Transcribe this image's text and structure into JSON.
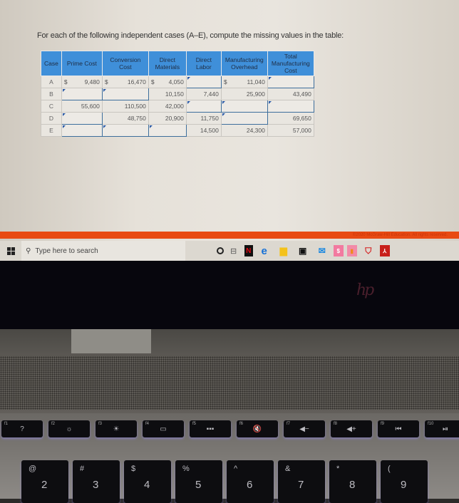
{
  "instructions": "For each of the following independent cases (A–E), compute the missing values in the table:",
  "table": {
    "headers": [
      "Case",
      "Prime Cost",
      "Conversion Cost",
      "Direct Materials",
      "Direct Labor",
      "Manufacturing Overhead",
      "Total Manufacturing Cost"
    ],
    "rows": [
      {
        "case": "A",
        "prime_cost": "9,480",
        "conversion_cost": "16,470",
        "direct_materials": "4,050",
        "direct_labor": "",
        "manufacturing_overhead": "11,040",
        "total_manufacturing_cost": ""
      },
      {
        "case": "B",
        "prime_cost": "",
        "conversion_cost": "",
        "direct_materials": "10,150",
        "direct_labor": "7,440",
        "manufacturing_overhead": "25,900",
        "total_manufacturing_cost": "43,490"
      },
      {
        "case": "C",
        "prime_cost": "55,600",
        "conversion_cost": "110,500",
        "direct_materials": "42,000",
        "direct_labor": "",
        "manufacturing_overhead": "",
        "total_manufacturing_cost": ""
      },
      {
        "case": "D",
        "prime_cost": "",
        "conversion_cost": "48,750",
        "direct_materials": "20,900",
        "direct_labor": "11,750",
        "manufacturing_overhead": "",
        "total_manufacturing_cost": "69,650"
      },
      {
        "case": "E",
        "prime_cost": "",
        "conversion_cost": "",
        "direct_materials": "",
        "direct_labor": "14,500",
        "manufacturing_overhead": "24,300",
        "total_manufacturing_cost": "57,000"
      }
    ],
    "currency_symbol": "$"
  },
  "copyright": "©2020 McGraw-Hill Education. All rights reserved.",
  "taskbar": {
    "search_placeholder": "Type here to search",
    "apps": [
      "netflix-icon",
      "edge-icon",
      "file-explorer-icon",
      "store-icon",
      "mail-icon",
      "app-pink-icon",
      "app-orange-icon",
      "mcafee-icon",
      "acrobat-icon"
    ]
  },
  "laptop_brand": "hp",
  "keyboard": {
    "function_keys": [
      {
        "fn": "f1",
        "symbol": "?"
      },
      {
        "fn": "f2",
        "symbol": "☼"
      },
      {
        "fn": "f3",
        "symbol": "☀"
      },
      {
        "fn": "f4",
        "symbol": "▭"
      },
      {
        "fn": "f5",
        "symbol": "▪▪▪"
      },
      {
        "fn": "f6",
        "symbol": "🔇"
      },
      {
        "fn": "f7",
        "symbol": "◀−"
      },
      {
        "fn": "f8",
        "symbol": "◀+"
      },
      {
        "fn": "f9",
        "symbol": "⏮"
      },
      {
        "fn": "f10",
        "symbol": "⏯"
      }
    ],
    "number_keys": [
      {
        "shift": "@",
        "main": "2"
      },
      {
        "shift": "#",
        "main": "3"
      },
      {
        "shift": "$",
        "main": "4"
      },
      {
        "shift": "%",
        "main": "5"
      },
      {
        "shift": "^",
        "main": "6"
      },
      {
        "shift": "&",
        "main": "7"
      },
      {
        "shift": "*",
        "main": "8"
      },
      {
        "shift": "(",
        "main": "9"
      }
    ]
  }
}
